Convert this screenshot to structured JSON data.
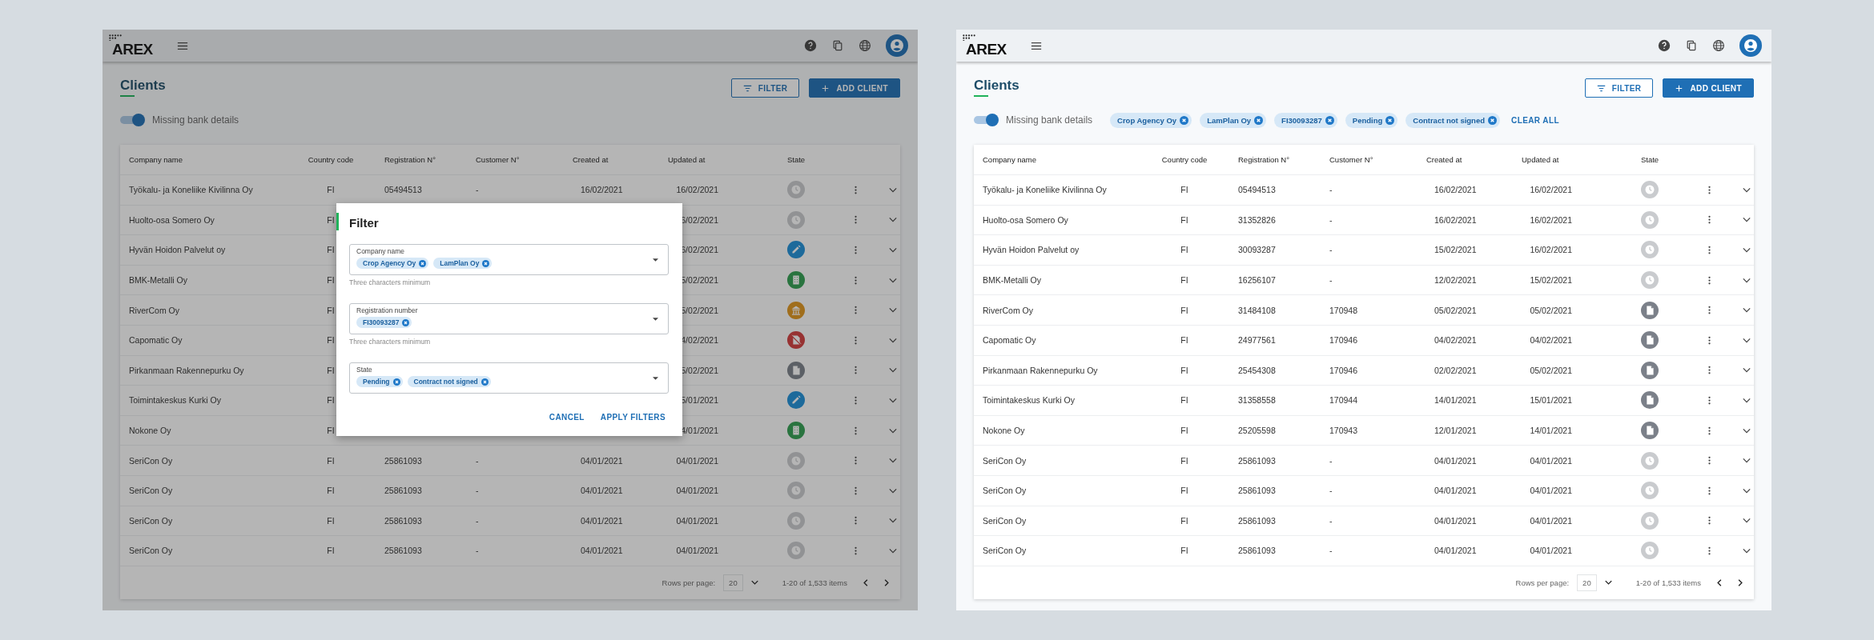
{
  "panels": [
    {
      "logo": "AREX",
      "title": "Clients",
      "filter_button": "FILTER",
      "add_button": "ADD CLIENT",
      "toggle": {
        "label": "Missing bank details",
        "on": true
      },
      "columns": [
        "Company name",
        "Country code",
        "Registration N°",
        "Customer N°",
        "Created at",
        "Updated at",
        "State"
      ],
      "rows": [
        {
          "company": "Työkalu- ja Koneliike Kivilinna Oy",
          "country": "FI",
          "registration": "05494513",
          "customer": "-",
          "created": "16/02/2021",
          "updated": "16/02/2021",
          "state": {
            "kind": "pending"
          }
        },
        {
          "company": "Huolto-osa Somero Oy",
          "country": "FI",
          "updated": "6/02/2021",
          "state": {
            "kind": "pending"
          }
        },
        {
          "company": "Hyvän Hoidon Palvelut oy",
          "country": "FI",
          "updated": "6/02/2021",
          "state": {
            "kind": "edit"
          }
        },
        {
          "company": "BMK-Metalli Oy",
          "country": "FI",
          "updated": "5/02/2021",
          "state": {
            "kind": "building"
          }
        },
        {
          "company": "RiverCom Oy",
          "country": "FI",
          "updated": "5/02/2021",
          "state": {
            "kind": "bank"
          }
        },
        {
          "company": "Capomatic Oy",
          "country": "FI",
          "updated": "4/02/2021",
          "state": {
            "kind": "blocked"
          }
        },
        {
          "company": "Pirkanmaan Rakennepurku Oy",
          "country": "FI",
          "updated": "5/02/2021",
          "state": {
            "kind": "document"
          }
        },
        {
          "company": "Toimintakeskus Kurki Oy",
          "country": "FI",
          "updated": "5/01/2021",
          "state": {
            "kind": "edit"
          }
        },
        {
          "company": "Nokone Oy",
          "country": "FI",
          "updated": "4/01/2021",
          "state": {
            "kind": "building"
          }
        },
        {
          "company": "SeriCon Oy",
          "country": "FI",
          "registration": "25861093",
          "customer": "-",
          "created": "04/01/2021",
          "updated": "04/01/2021",
          "state": {
            "kind": "pending"
          }
        },
        {
          "company": "SeriCon Oy",
          "country": "FI",
          "registration": "25861093",
          "customer": "-",
          "created": "04/01/2021",
          "updated": "04/01/2021",
          "state": {
            "kind": "pending"
          }
        },
        {
          "company": "SeriCon Oy",
          "country": "FI",
          "registration": "25861093",
          "customer": "-",
          "created": "04/01/2021",
          "updated": "04/01/2021",
          "state": {
            "kind": "pending"
          }
        },
        {
          "company": "SeriCon Oy",
          "country": "FI",
          "registration": "25861093",
          "customer": "-",
          "created": "04/01/2021",
          "updated": "04/01/2021",
          "state": {
            "kind": "pending"
          }
        }
      ],
      "pagination": {
        "label": "Rows per page:",
        "rows_per_page": "20",
        "range": "1-20 of 1,533 items"
      },
      "dialog": {
        "title": "Filter",
        "fields": [
          {
            "label": "Company name",
            "chips": [
              "Crop Agency Oy",
              "LamPlan Oy"
            ],
            "helper": "Three characters minimum"
          },
          {
            "label": "Registration number",
            "chips": [
              "FI30093287"
            ],
            "helper": "Three characters minimum"
          },
          {
            "label": "State",
            "chips": [
              "Pending",
              "Contract not signed"
            ]
          }
        ],
        "cancel": "CANCEL",
        "apply": "APPLY FILTERS"
      }
    },
    {
      "logo": "AREX",
      "title": "Clients",
      "filter_button": "FILTER",
      "add_button": "ADD CLIENT",
      "toggle": {
        "label": "Missing bank details",
        "on": true
      },
      "filter_chips": [
        "Crop Agency Oy",
        "LamPlan Oy",
        "FI30093287",
        "Pending",
        "Contract not signed"
      ],
      "clear_all": "CLEAR ALL",
      "columns": [
        "Company name",
        "Country code",
        "Registration N°",
        "Customer N°",
        "Created at",
        "Updated at",
        "State"
      ],
      "rows": [
        {
          "company": "Työkalu- ja Koneliike Kivilinna Oy",
          "country": "FI",
          "registration": "05494513",
          "customer": "-",
          "created": "16/02/2021",
          "updated": "16/02/2021",
          "state": {
            "kind": "pending"
          }
        },
        {
          "company": "Huolto-osa Somero Oy",
          "country": "FI",
          "registration": "31352826",
          "customer": "-",
          "created": "16/02/2021",
          "updated": "16/02/2021",
          "state": {
            "kind": "pending"
          }
        },
        {
          "company": "Hyvän Hoidon Palvelut oy",
          "country": "FI",
          "registration": "30093287",
          "customer": "-",
          "created": "15/02/2021",
          "updated": "16/02/2021",
          "state": {
            "kind": "pending"
          }
        },
        {
          "company": "BMK-Metalli Oy",
          "country": "FI",
          "registration": "16256107",
          "customer": "-",
          "created": "12/02/2021",
          "updated": "15/02/2021",
          "state": {
            "kind": "pending"
          }
        },
        {
          "company": "RiverCom Oy",
          "country": "FI",
          "registration": "31484108",
          "customer": "170948",
          "created": "05/02/2021",
          "updated": "05/02/2021",
          "state": {
            "kind": "document"
          }
        },
        {
          "company": "Capomatic Oy",
          "country": "FI",
          "registration": "24977561",
          "customer": "170946",
          "created": "04/02/2021",
          "updated": "04/02/2021",
          "state": {
            "kind": "document"
          }
        },
        {
          "company": "Pirkanmaan Rakennepurku Oy",
          "country": "FI",
          "registration": "25454308",
          "customer": "170946",
          "created": "02/02/2021",
          "updated": "05/02/2021",
          "state": {
            "kind": "document"
          }
        },
        {
          "company": "Toimintakeskus Kurki Oy",
          "country": "FI",
          "registration": "31358558",
          "customer": "170944",
          "created": "14/01/2021",
          "updated": "15/01/2021",
          "state": {
            "kind": "document"
          }
        },
        {
          "company": "Nokone Oy",
          "country": "FI",
          "registration": "25205598",
          "customer": "170943",
          "created": "12/01/2021",
          "updated": "14/01/2021",
          "state": {
            "kind": "document"
          }
        },
        {
          "company": "SeriCon Oy",
          "country": "FI",
          "registration": "25861093",
          "customer": "-",
          "created": "04/01/2021",
          "updated": "04/01/2021",
          "state": {
            "kind": "pending"
          }
        },
        {
          "company": "SeriCon Oy",
          "country": "FI",
          "registration": "25861093",
          "customer": "-",
          "created": "04/01/2021",
          "updated": "04/01/2021",
          "state": {
            "kind": "pending"
          }
        },
        {
          "company": "SeriCon Oy",
          "country": "FI",
          "registration": "25861093",
          "customer": "-",
          "created": "04/01/2021",
          "updated": "04/01/2021",
          "state": {
            "kind": "pending"
          }
        },
        {
          "company": "SeriCon Oy",
          "country": "FI",
          "registration": "25861093",
          "customer": "-",
          "created": "04/01/2021",
          "updated": "04/01/2021",
          "state": {
            "kind": "pending"
          }
        }
      ],
      "pagination": {
        "label": "Rows per page:",
        "rows_per_page": "20",
        "range": "1-20 of 1,533 items"
      }
    }
  ]
}
